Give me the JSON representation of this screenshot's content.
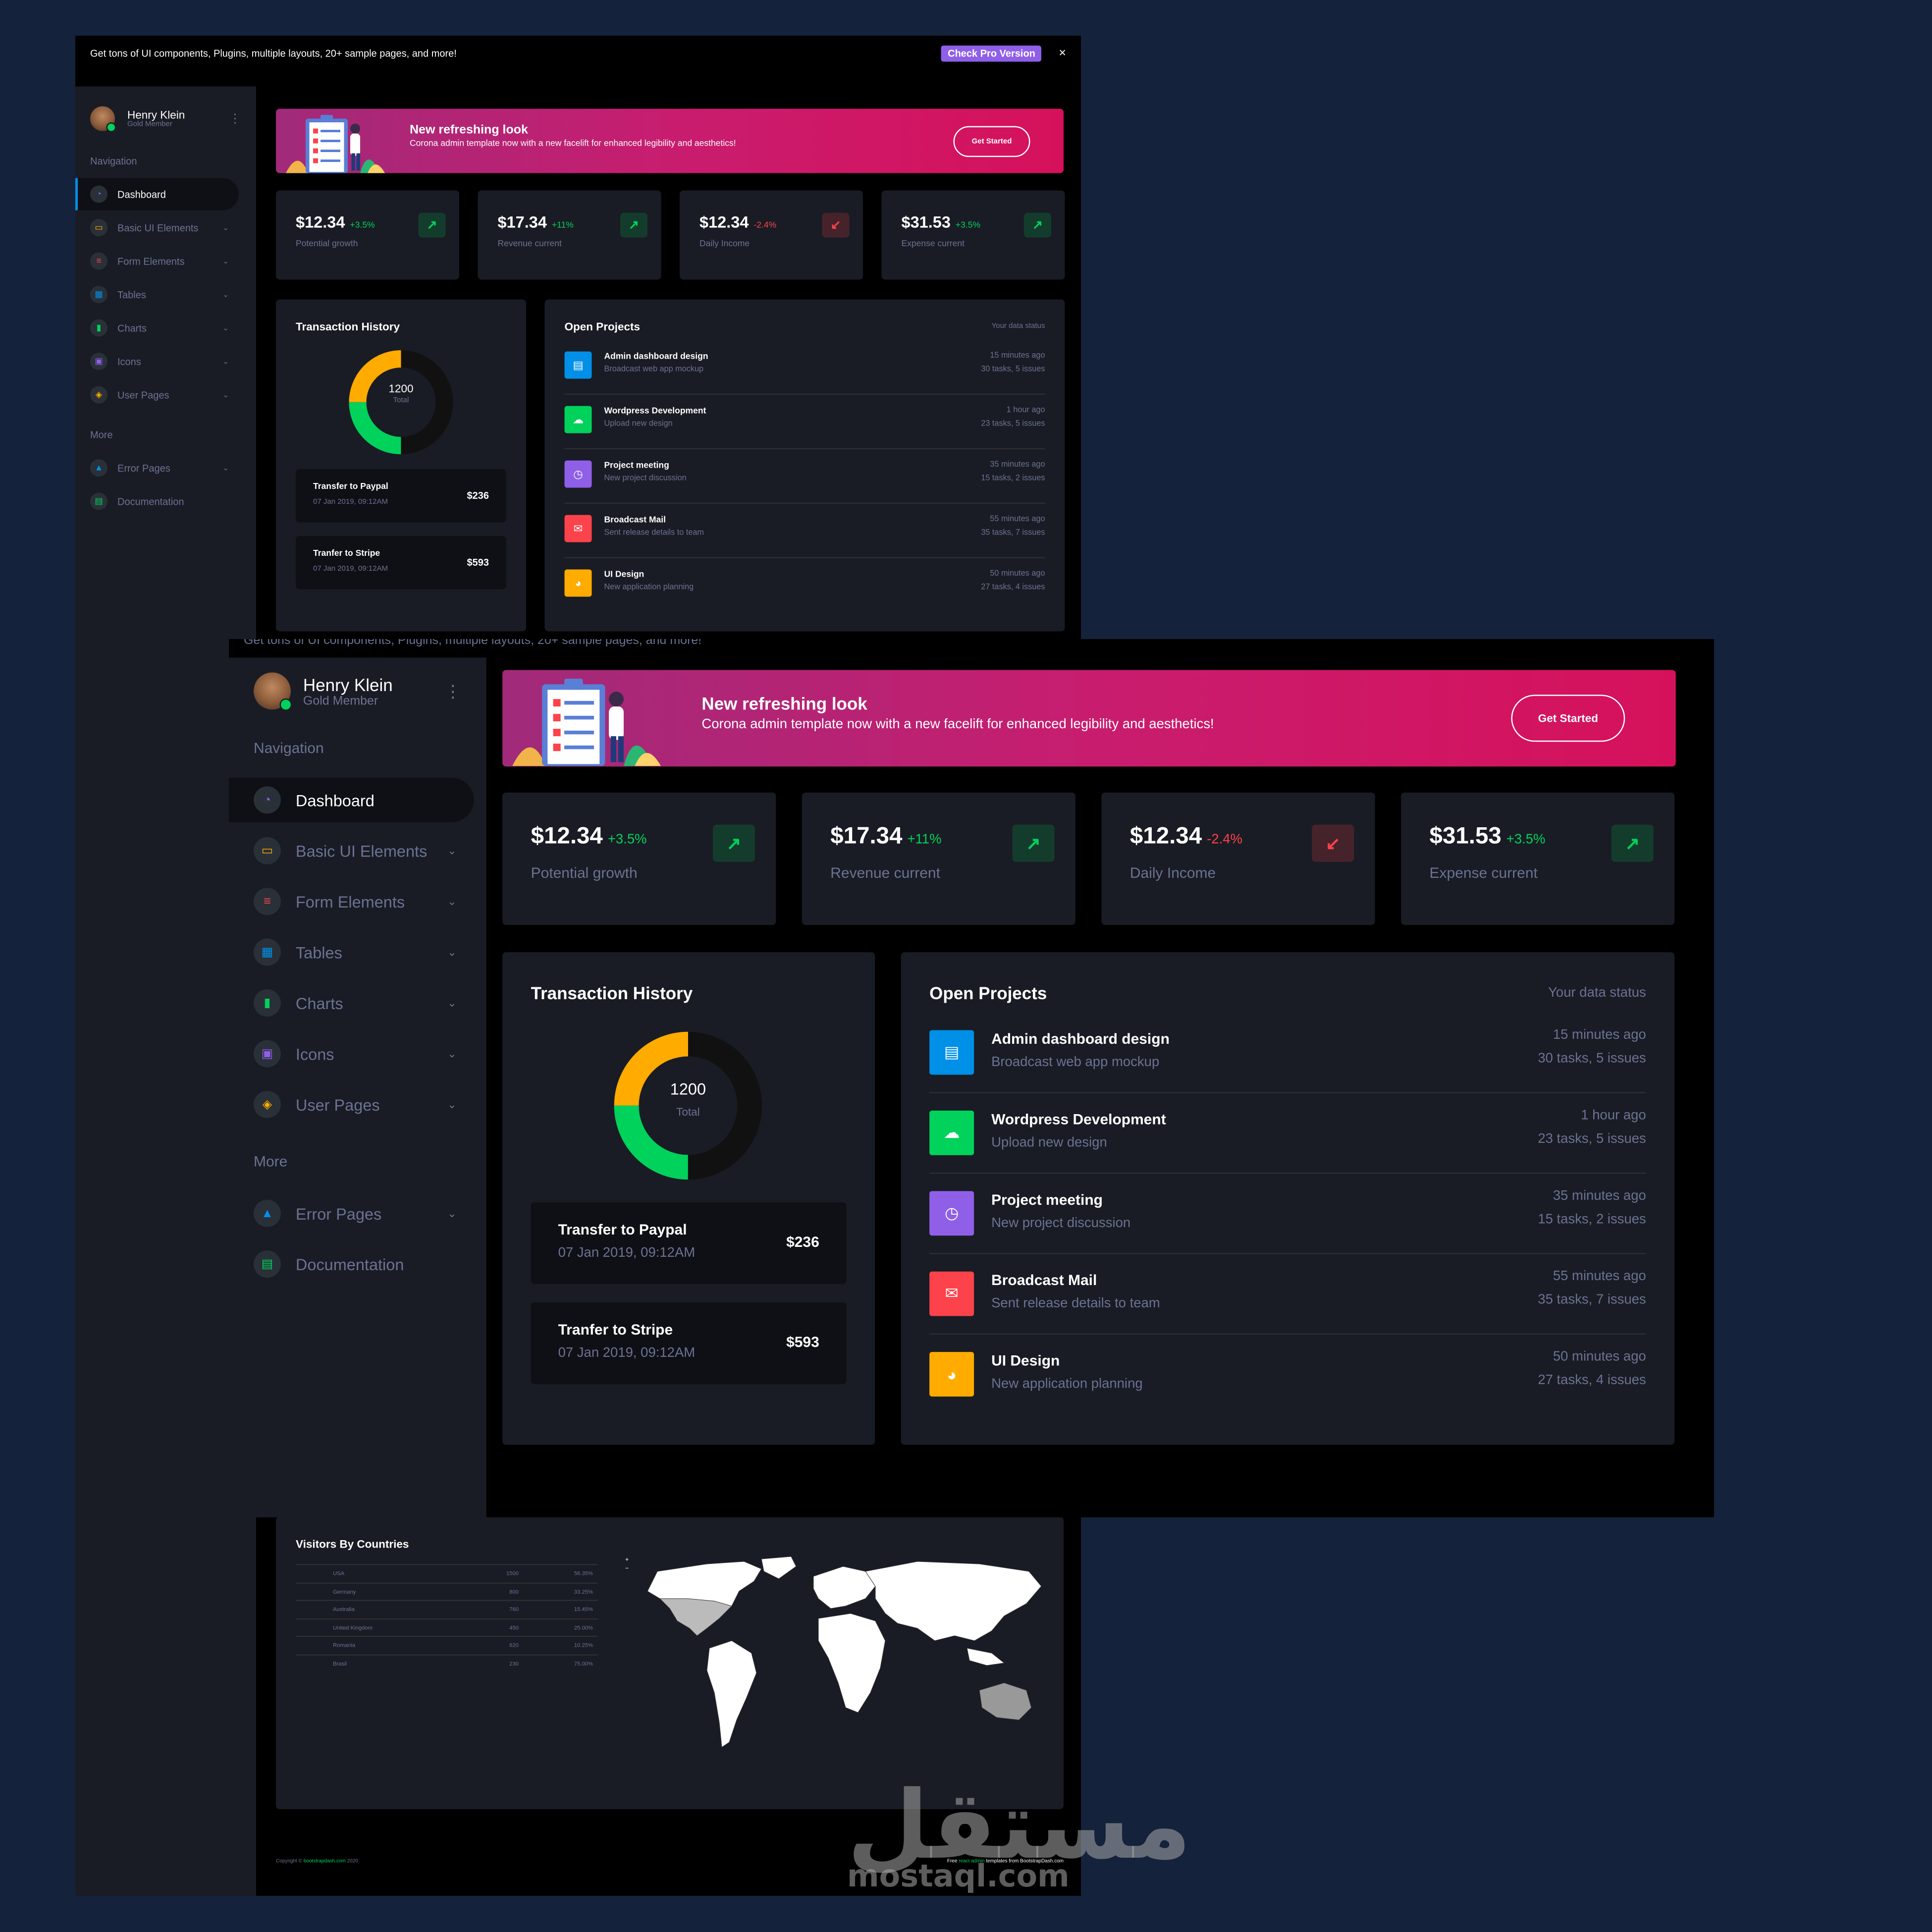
{
  "promo": {
    "text": "Get tons of UI components, Plugins, multiple layouts, 20+ sample pages, and more!",
    "pro_button": "Check Pro Version",
    "close": "×"
  },
  "profile": {
    "name": "Henry Klein",
    "role": "Gold Member"
  },
  "sidebar": {
    "nav_heading": "Navigation",
    "more_heading": "More",
    "items": [
      {
        "label": "Dashboard",
        "icon": "speedometer-icon",
        "color": "#8f5fe8"
      },
      {
        "label": "Basic UI Elements",
        "icon": "laptop-icon",
        "color": "#ffab00"
      },
      {
        "label": "Form Elements",
        "icon": "playlist-icon",
        "color": "#fc424a"
      },
      {
        "label": "Tables",
        "icon": "table-icon",
        "color": "#0090e7"
      },
      {
        "label": "Charts",
        "icon": "chart-bar-icon",
        "color": "#00d25b"
      },
      {
        "label": "Icons",
        "icon": "contacts-icon",
        "color": "#8f5fe8"
      },
      {
        "label": "User Pages",
        "icon": "security-icon",
        "color": "#ffab00"
      }
    ],
    "more_items": [
      {
        "label": "Error Pages",
        "icon": "lock-icon",
        "color": "#0090e7"
      },
      {
        "label": "Documentation",
        "icon": "file-document-icon",
        "color": "#00d25b"
      }
    ]
  },
  "banner": {
    "title": "New refreshing look",
    "subtitle": "Corona admin template now with a new facelift for enhanced legibility and aesthetics!",
    "button": "Get Started"
  },
  "stats": [
    {
      "value": "$12.34",
      "change": "+3.5%",
      "label": "Potential growth",
      "trend": "up"
    },
    {
      "value": "$17.34",
      "change": "+11%",
      "label": "Revenue current",
      "trend": "up"
    },
    {
      "value": "$12.34",
      "change": "-2.4%",
      "label": "Daily Income",
      "trend": "down"
    },
    {
      "value": "$31.53",
      "change": "+3.5%",
      "label": "Expense current",
      "trend": "up"
    }
  ],
  "transactions": {
    "title": "Transaction History",
    "total_value": "1200",
    "total_label": "Total",
    "donut": [
      {
        "color": "#111111",
        "share": 0.5
      },
      {
        "color": "#00d25b",
        "share": 0.25
      },
      {
        "color": "#ffab00",
        "share": 0.25
      }
    ],
    "items": [
      {
        "name": "Transfer to Paypal",
        "date": "07 Jan 2019, 09:12AM",
        "amount": "$236"
      },
      {
        "name": "Tranfer to Stripe",
        "date": "07 Jan 2019, 09:12AM",
        "amount": "$593"
      }
    ]
  },
  "projects": {
    "title": "Open Projects",
    "status": "Your data status",
    "items": [
      {
        "name": "Admin dashboard design",
        "desc": "Broadcast web app mockup",
        "time": "15 minutes ago",
        "tasks": "30 tasks, 5 issues",
        "color": "#0090e7",
        "icon": "file-icon"
      },
      {
        "name": "Wordpress Development",
        "desc": "Upload new design",
        "time": "1 hour ago",
        "tasks": "23 tasks, 5 issues",
        "color": "#00d25b",
        "icon": "cloud-upload-icon"
      },
      {
        "name": "Project meeting",
        "desc": "New project discussion",
        "time": "35 minutes ago",
        "tasks": "15 tasks, 2 issues",
        "color": "#8f5fe8",
        "icon": "clock-icon"
      },
      {
        "name": "Broadcast Mail",
        "desc": "Sent release details to team",
        "time": "55 minutes ago",
        "tasks": "35 tasks, 7 issues",
        "color": "#fc424a",
        "icon": "email-open-icon"
      },
      {
        "name": "UI Design",
        "desc": "New application planning",
        "time": "50 minutes ago",
        "tasks": "27 tasks, 4 issues",
        "color": "#ffab00",
        "icon": "chart-pie-icon"
      }
    ]
  },
  "visitors": {
    "title": "Visitors By Countries",
    "zoom_in": "+",
    "zoom_out": "−",
    "rows": [
      {
        "country": "USA",
        "visits": "1500",
        "percent": "56.35%"
      },
      {
        "country": "Germany",
        "visits": "800",
        "percent": "33.25%"
      },
      {
        "country": "Australia",
        "visits": "760",
        "percent": "15.45%"
      },
      {
        "country": "United Kingdom",
        "visits": "450",
        "percent": "25.00%"
      },
      {
        "country": "Romania",
        "visits": "620",
        "percent": "10.25%"
      },
      {
        "country": "Brasil",
        "visits": "230",
        "percent": "75.00%"
      }
    ]
  },
  "footer": {
    "copy_prefix": "Copyright © ",
    "copy_link": "bootstrapdash.com",
    "copy_year": " 2020",
    "free_prefix": "Free ",
    "free_link": "react admin",
    "free_suffix": " templates from BootstrapDash.com"
  },
  "watermark": {
    "arabic": "مستقل",
    "latin": "mostaql.com"
  }
}
